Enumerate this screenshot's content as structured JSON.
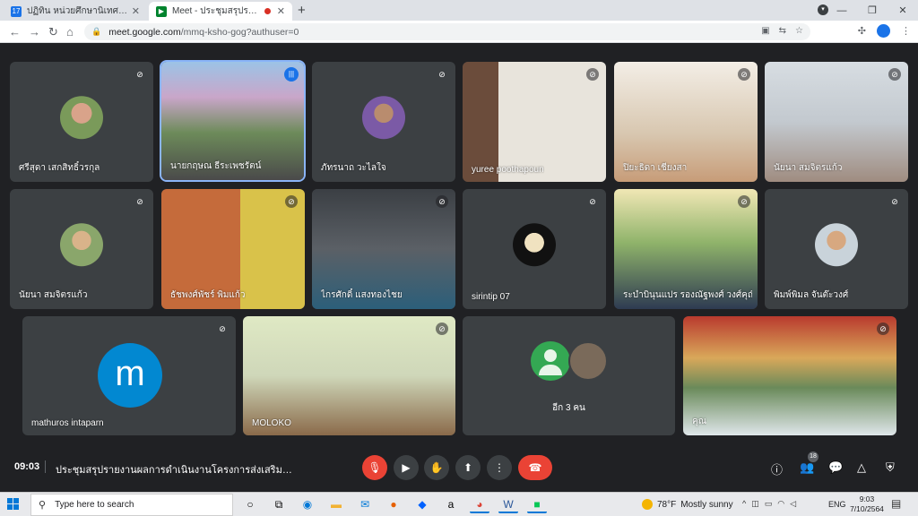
{
  "browser": {
    "tabs": [
      {
        "title": "ปฏิทิน หน่วยศึกษานิเทศก์ สพฐ. - วันศ",
        "favicon": "17",
        "favicon_color": "#1a73e8",
        "active": false
      },
      {
        "title": "Meet - ประชุมสรุปรายงานผลการดำ",
        "favicon": "M",
        "favicon_color": "#00832d",
        "active": true,
        "recording": true
      }
    ],
    "new_tab_label": "+",
    "url_host": "meet.google.com",
    "url_path": "/mmq-ksho-gog?authuser=0"
  },
  "meet": {
    "participants": [
      {
        "name": "ศรีสุดา เสกสิทธิ์วรกุล",
        "type": "avatar"
      },
      {
        "name": "นายกฤษณ ธีระเพชรัตน์",
        "type": "video",
        "speaking": true
      },
      {
        "name": "ภัทรนาถ วะไลใจ",
        "type": "avatar"
      },
      {
        "name": "yuree poothapoun",
        "type": "video"
      },
      {
        "name": "ปิยะธิดา เชียงสา",
        "type": "video"
      },
      {
        "name": "นัยนา สมจิตรแก้ว",
        "type": "video"
      },
      {
        "name": "นัยนา สมจิตรแก้ว",
        "type": "avatar"
      },
      {
        "name": "ธัชพงศ์พัชร์ พิมแก้ว",
        "type": "video"
      },
      {
        "name": "ไกรศักดิ์ แสงทองไชย",
        "type": "video"
      },
      {
        "name": "sirintip 07",
        "type": "avatar"
      },
      {
        "name": "ระบำบินุนแปร รองณัฐพงศ์ วงศ์คุณิ...",
        "type": "video"
      },
      {
        "name": "พิมพ์พิมล จันต๊ะวงศ์",
        "type": "avatar"
      },
      {
        "name": "mathuros intaparn",
        "type": "letter",
        "letter": "m",
        "color": "#0288d1"
      },
      {
        "name": "MOLOKO",
        "type": "video"
      },
      {
        "name": "อีก 3 คน",
        "type": "others"
      },
      {
        "name": "คุณ",
        "type": "video",
        "self": true
      }
    ],
    "clock": "09:03",
    "meeting_title": "ประชุมสรุปรายงานผลการดำเนินงานโครงการส่งเสริมและพั...",
    "participant_count": "18"
  },
  "taskbar": {
    "search_placeholder": "Type here to search",
    "weather_temp": "78°F",
    "weather_text": "Mostly sunny",
    "language": "ENG",
    "time": "9:03",
    "date": "7/10/2564"
  }
}
